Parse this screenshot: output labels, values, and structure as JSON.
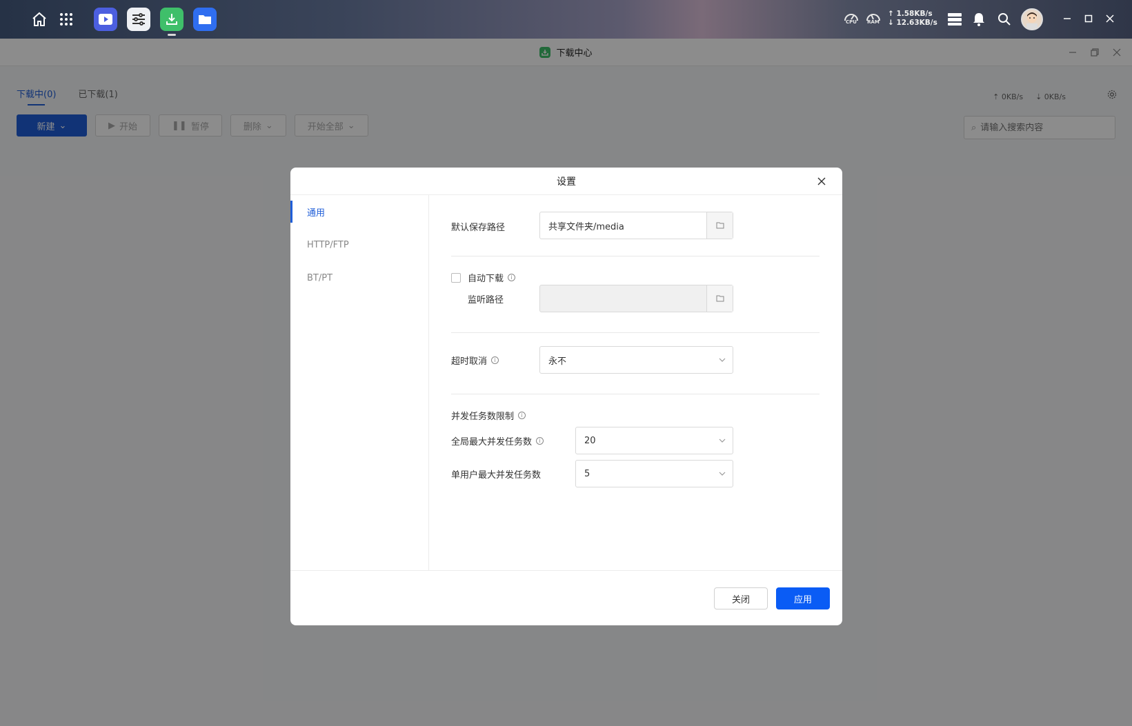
{
  "topbar": {
    "cpu_label": "CPU",
    "ram_label": "RAM",
    "upload_rate": "↑ 1.58KB/s",
    "download_rate": "↓ 12.63KB/s"
  },
  "app": {
    "title": "下载中心",
    "tabs": [
      {
        "label": "下载中(0)",
        "active": true
      },
      {
        "label": "已下载(1)",
        "active": false
      }
    ],
    "upload_speed": "0KB/s",
    "download_speed": "0KB/s",
    "toolbar": {
      "new": "新建",
      "start": "开始",
      "pause": "暂停",
      "delete": "删除",
      "start_all": "开始全部"
    },
    "search_placeholder": "请输入搜索内容"
  },
  "dialog": {
    "title": "设置",
    "sidebar": [
      {
        "label": "通用",
        "active": true
      },
      {
        "label": "HTTP/FTP",
        "active": false
      },
      {
        "label": "BT/PT",
        "active": false
      }
    ],
    "default_path_label": "默认保存路径",
    "default_path_value": "共享文件夹/media",
    "auto_download_label": "自动下载",
    "auto_download_checked": false,
    "watch_path_label": "监听路径",
    "watch_path_value": "",
    "timeout_label": "超时取消",
    "timeout_value": "永不",
    "concurrency_label": "并发任务数限制",
    "global_max_label": "全局最大并发任务数",
    "global_max_value": "20",
    "per_user_label": "单用户最大并发任务数",
    "per_user_value": "5",
    "close_button": "关闭",
    "apply_button": "应用"
  },
  "colors": {
    "primary": "#1f5ed8",
    "apply": "#0a5cf5"
  }
}
